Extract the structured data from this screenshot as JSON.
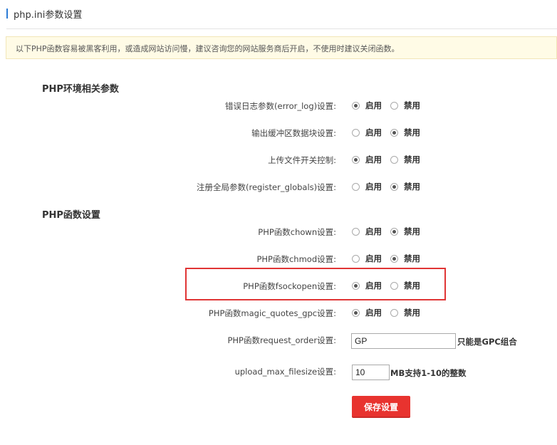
{
  "page_title": "php.ini参数设置",
  "notice": "以下PHP函数容易被黑客利用，或造成网站访问慢，建议咨询您的网站服务商后开启，不使用时建议关闭函数。",
  "option_labels": {
    "enable": "启用",
    "disable": "禁用"
  },
  "sections": [
    {
      "title": "PHP环境相关参数",
      "rows": [
        {
          "label": "错误日志参数(error_log)设置:",
          "value": "启用"
        },
        {
          "label": "输出缓冲区数据块设置:",
          "value": "禁用"
        },
        {
          "label": "上传文件开关控制:",
          "value": "启用"
        },
        {
          "label": "注册全局参数(register_globals)设置:",
          "value": "禁用"
        }
      ]
    },
    {
      "title": "PHP函数设置",
      "rows": [
        {
          "label": "PHP函数chown设置:",
          "value": "禁用"
        },
        {
          "label": "PHP函数chmod设置:",
          "value": "禁用"
        },
        {
          "label": "PHP函数fsockopen设置:",
          "value": "启用"
        },
        {
          "label": "PHP函数magic_quotes_gpc设置:",
          "value": "启用"
        }
      ]
    }
  ],
  "request_order": {
    "label": "PHP函数request_order设置:",
    "value": "GP",
    "hint": "只能是GPC组合"
  },
  "upload_max_filesize": {
    "label": "upload_max_filesize设置:",
    "value": "10",
    "hint": "MB支持1-10的整数"
  },
  "save_button": "保存设置",
  "colors": {
    "accent_bar": "#2b7bd6",
    "highlight_border": "#e03535",
    "save_button_bg": "#e8332f",
    "notice_bg": "#fffbe6"
  }
}
